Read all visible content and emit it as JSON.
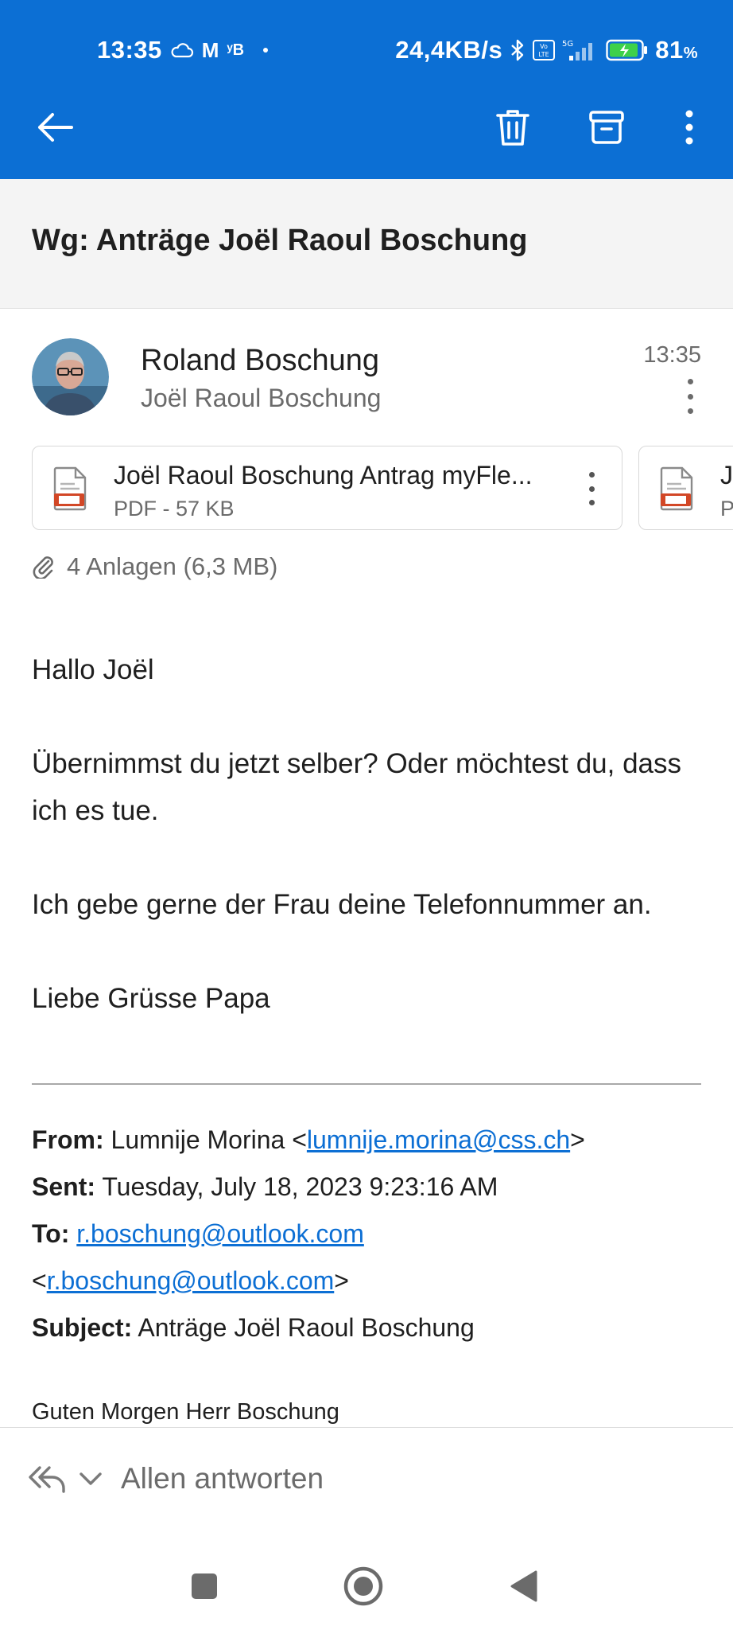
{
  "status_bar": {
    "time": "13:35",
    "left_icons": [
      "cloud-icon",
      "gmail-icon",
      "notification-icon",
      "dot-icon"
    ],
    "network_speed": "24,4KB/s",
    "right_icons": [
      "bluetooth-icon",
      "volte-icon",
      "5g-signal-icon",
      "battery-charging-icon"
    ],
    "battery_percent": "81",
    "battery_unit": "%"
  },
  "toolbar": {
    "back_icon": "arrow-left-icon",
    "delete_icon": "trash-icon",
    "archive_icon": "archive-icon",
    "more_icon": "more-vertical-icon"
  },
  "email": {
    "subject": "Wg: Anträge Joël Raoul Boschung",
    "sender": "Roland Boschung",
    "recipient": "Joël Raoul Boschung",
    "time": "13:35",
    "attachments": [
      {
        "name": "Joël Raoul Boschung Antrag myFle...",
        "meta": "PDF - 57 KB"
      },
      {
        "name": "J",
        "meta": "P"
      }
    ],
    "attachment_summary": "4 Anlagen (6,3 MB)",
    "body": [
      "Hallo Joël",
      "Übernimmst du jetzt selber? Oder möchtest du, dass ich es tue.",
      "Ich gebe gerne der Frau deine Telefonnummer an.",
      "Liebe Grüsse Papa"
    ],
    "forwarded": {
      "from_label": "From:",
      "from_name": "Lumnije Morina <",
      "from_email": "lumnije.morina@css.ch",
      "from_close": ">",
      "sent_label": "Sent:",
      "sent_value": "Tuesday, July 18, 2023 9:23:16 AM",
      "to_label": "To:",
      "to_email": "r.boschung@outlook.com",
      "to_open": "<",
      "to_email_2": "r.boschung@outlook.com",
      "to_close": ">",
      "subject_label": "Subject:",
      "subject_value": "Anträge Joël Raoul Boschung",
      "greeting": "Guten Morgen Herr Boschung"
    }
  },
  "reply_bar": {
    "label": "Allen antworten",
    "icon": "reply-all-icon"
  },
  "nav_bar": {
    "buttons": [
      "recents-square-icon",
      "home-circle-icon",
      "back-triangle-icon"
    ]
  },
  "colors": {
    "brand": "#0c6fd4",
    "link": "#0c6fd4",
    "text": "#1f1f1f",
    "muted": "#6b6b6b"
  }
}
